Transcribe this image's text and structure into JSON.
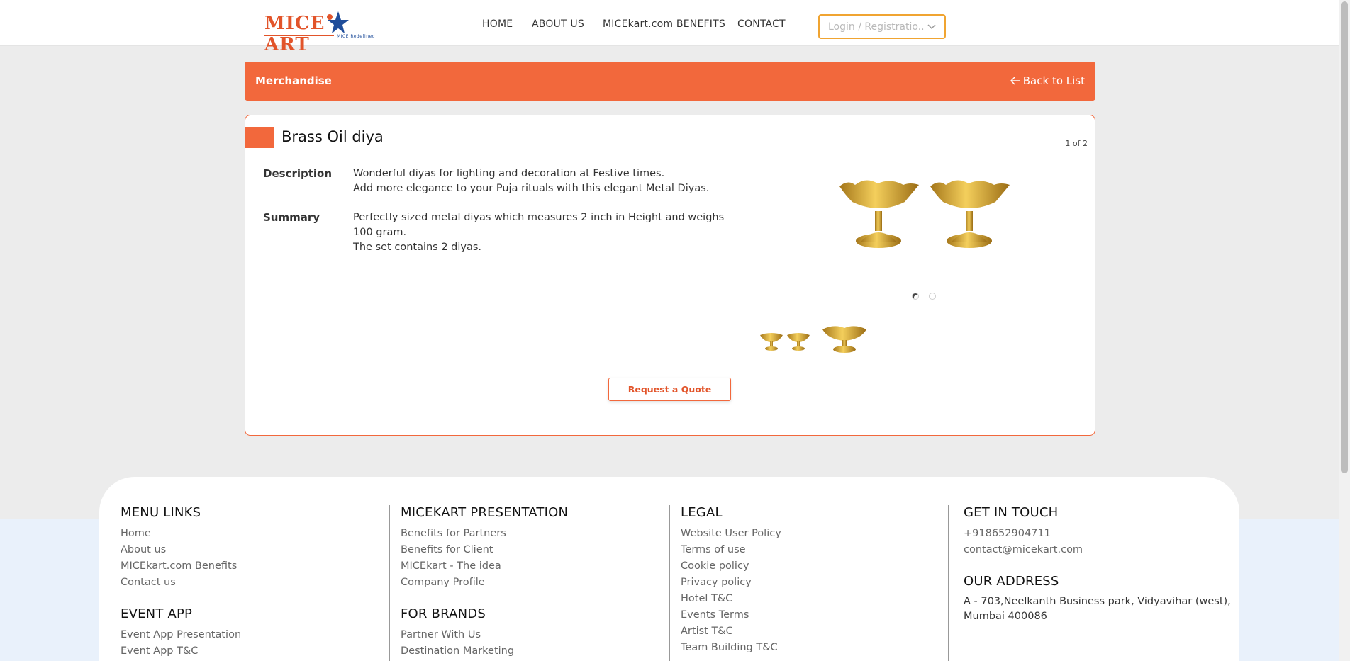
{
  "header": {
    "logo_text": "MICE",
    "logo_text_2": "ART",
    "logo_tagline": "MICE Redefined",
    "nav": [
      "HOME",
      "ABOUT US",
      "MICEkart.com BENEFITS",
      "CONTACT"
    ],
    "login_placeholder": "Login / Registratio..."
  },
  "breadcrumb": {
    "title": "Merchandise",
    "back_label": "Back to List"
  },
  "product": {
    "title": "Brass Oil diya",
    "counter": "1 of 2",
    "description_label": "Description",
    "description_lines": [
      "Wonderful diyas for lighting and decoration at Festive times.",
      "Add more elegance to your Puja rituals with this elegant Metal Diyas."
    ],
    "summary_label": "Summary",
    "summary_lines": [
      "Perfectly sized metal  diyas which  measures 2 inch in Height and weighs 100 gram.",
      "The set contains 2 diyas."
    ],
    "carousel_total": 2,
    "carousel_active": 1,
    "quote_button": "Request a Quote"
  },
  "footer": {
    "menu_links": {
      "title": "MENU LINKS",
      "items": [
        "Home",
        "About us",
        "MICEkart.com Benefits",
        "Contact us"
      ]
    },
    "event_app": {
      "title": "EVENT APP",
      "items": [
        "Event App Presentation",
        "Event App T&C"
      ]
    },
    "presentation": {
      "title": "MICEKART PRESENTATION",
      "items": [
        "Benefits for Partners",
        "Benefits for Client",
        "MICEkart - The idea",
        "Company Profile"
      ]
    },
    "brands": {
      "title": "FOR BRANDS",
      "items": [
        "Partner With Us",
        "Destination Marketing"
      ]
    },
    "legal": {
      "title": "LEGAL",
      "items": [
        "Website User Policy",
        "Terms of use",
        "Cookie policy",
        "Privacy policy",
        "Hotel T&C",
        "Events Terms",
        "Artist T&C",
        "Team Building T&C"
      ]
    },
    "contact": {
      "title": "GET IN TOUCH",
      "phone": "+918652904711",
      "email": "contact@micekart.com"
    },
    "address": {
      "title": "OUR ADDRESS",
      "lines": [
        "A - 703,Neelkanth Business park, Vidyavihar (west),",
        "Mumbai 400086"
      ]
    }
  },
  "colors": {
    "accent": "#f2683c",
    "login_border": "#f0a431",
    "brass": "#d4a22a",
    "brand_blue": "#1f4d9a"
  }
}
